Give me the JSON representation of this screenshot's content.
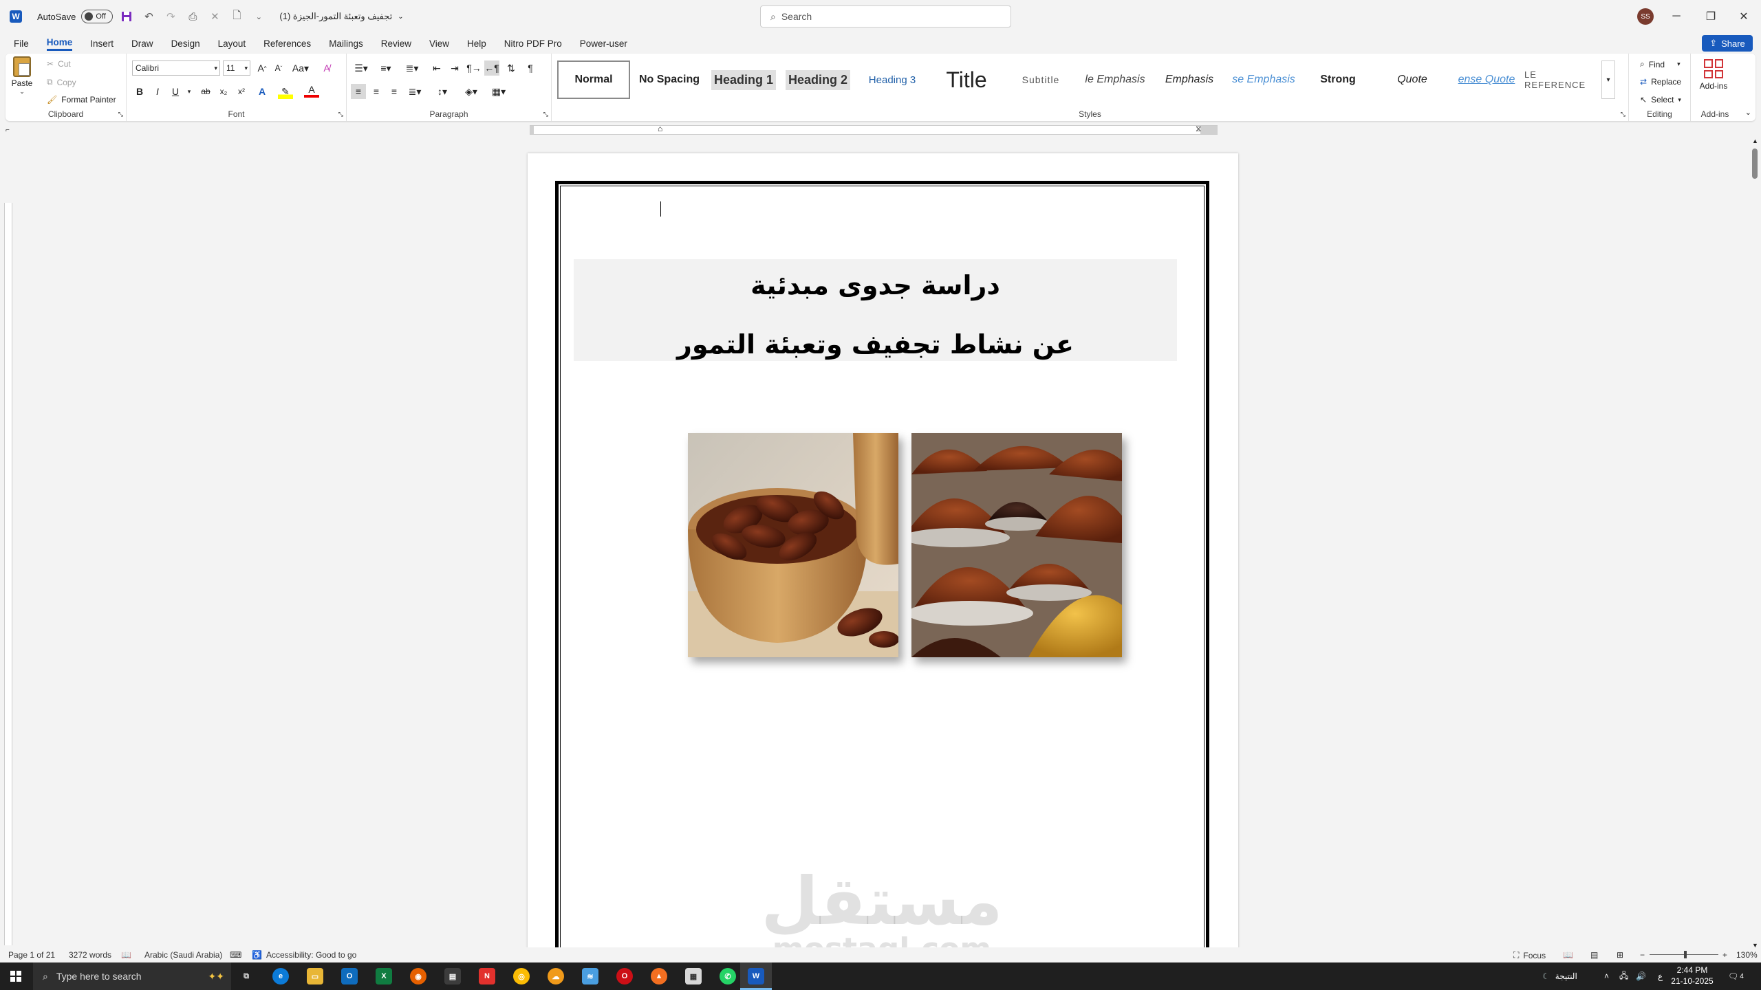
{
  "titlebar": {
    "autosave_label": "AutoSave",
    "autosave_state": "Off",
    "doc_title": "تجفيف وتعبئة التمور-الجيزة (1)",
    "search_placeholder": "Search",
    "user_initials": "SS"
  },
  "menu": {
    "tabs": [
      "File",
      "Home",
      "Insert",
      "Draw",
      "Design",
      "Layout",
      "References",
      "Mailings",
      "Review",
      "View",
      "Help",
      "Nitro PDF Pro",
      "Power-user"
    ],
    "active": "Home",
    "share_label": "Share"
  },
  "ribbon": {
    "clipboard": {
      "label": "Clipboard",
      "paste": "Paste",
      "cut": "Cut",
      "copy": "Copy",
      "format_painter": "Format Painter"
    },
    "font": {
      "label": "Font",
      "family": "Calibri",
      "size": "11"
    },
    "paragraph": {
      "label": "Paragraph"
    },
    "styles": {
      "label": "Styles",
      "items": [
        "Normal",
        "No Spacing",
        "Heading 1",
        "Heading 2",
        "Heading 3",
        "Title",
        "Subtitle",
        "le Emphasis",
        "Emphasis",
        "se Emphasis",
        "Strong",
        "Quote",
        "ense Quote",
        "LE REFERENCE"
      ]
    },
    "editing": {
      "label": "Editing",
      "find": "Find",
      "replace": "Replace",
      "select": "Select"
    },
    "addins": {
      "label": "Add-ins",
      "button": "Add-ins"
    }
  },
  "document": {
    "title_line1": "دراسة جدوى مبدئية",
    "title_line2": "عن نشاط تجفيف وتعبئة التمور",
    "watermark_ar": "مستقل",
    "watermark_en": "mostaql.com"
  },
  "statusbar": {
    "page": "Page 1 of 21",
    "words": "3272 words",
    "language": "Arabic (Saudi Arabia)",
    "accessibility": "Accessibility: Good to go",
    "focus": "Focus",
    "zoom": "130%"
  },
  "taskbar": {
    "search_placeholder": "Type here to search",
    "weather": "النتيجة",
    "time": "2:44 PM",
    "date": "21-10-2025",
    "notification_count": "4",
    "lang": "ع"
  }
}
